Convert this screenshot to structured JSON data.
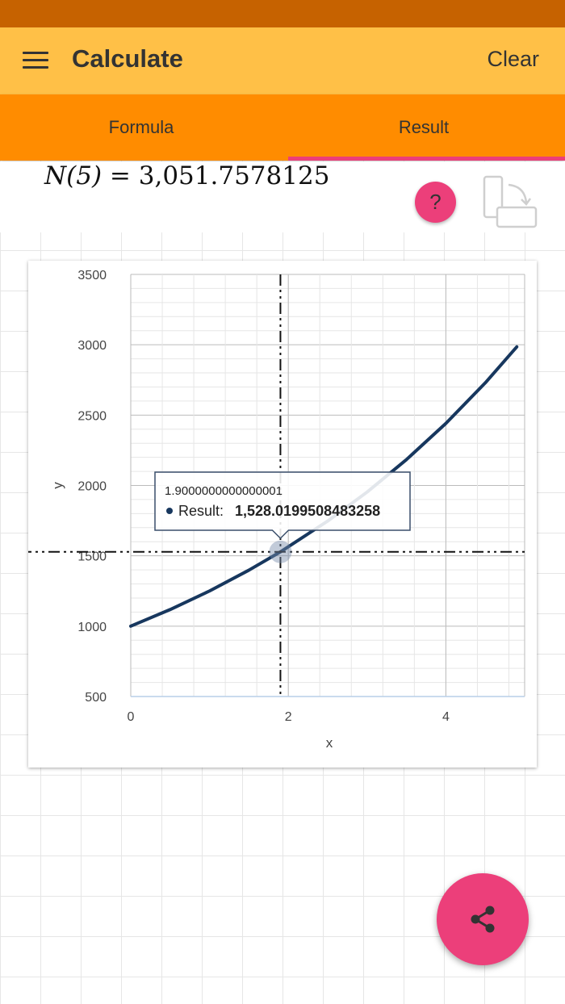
{
  "app": {
    "title": "Calculate",
    "clear_label": "Clear"
  },
  "tabs": [
    {
      "label": "Formula",
      "selected": false
    },
    {
      "label": "Result",
      "selected": true
    }
  ],
  "result": {
    "lhs": "N(5)",
    "equals": "=",
    "value": "3,051.7578125"
  },
  "help": {
    "label": "?"
  },
  "icons": {
    "menu": "menu-icon",
    "rotate": "rotate-screen-icon",
    "share": "share-icon"
  },
  "colors": {
    "status_bar": "#c66200",
    "app_bar": "#ffc047",
    "tab_bar": "#ff8c00",
    "accent": "#ec3f7a",
    "series": "#17375e"
  },
  "chart_data": {
    "type": "line",
    "xlabel": "x",
    "ylabel": "y",
    "xlim": [
      0,
      5
    ],
    "ylim": [
      500,
      3500
    ],
    "x_ticks": [
      "0",
      "2",
      "4"
    ],
    "y_ticks": [
      "500",
      "1000",
      "1500",
      "2000",
      "2500",
      "3000",
      "3500"
    ],
    "grid": true,
    "series": [
      {
        "name": "Result",
        "x": [
          0,
          0.5,
          1,
          1.5,
          1.9,
          2.5,
          3,
          3.5,
          4,
          4.5,
          4.9
        ],
        "y": [
          1000,
          1118,
          1250,
          1398,
          1528,
          1747,
          1953,
          2184,
          2441,
          2729,
          2985
        ]
      }
    ],
    "tooltip": {
      "x_label": "1.9000000000000001",
      "series_name": "Result:",
      "value": "1,528.0199508483258",
      "x": 1.9,
      "y": 1528.02
    }
  }
}
